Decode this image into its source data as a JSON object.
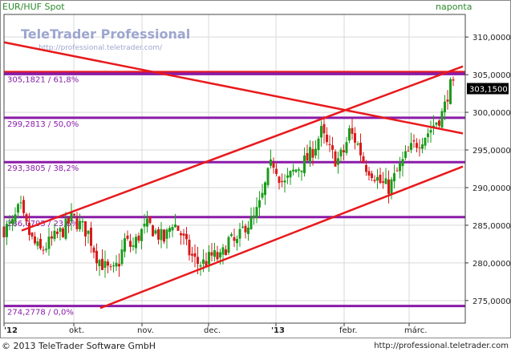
{
  "header": {
    "instrument": "EUR/HUF Spot",
    "period": "naponta"
  },
  "watermark": {
    "brand": "TeleTrader Professional",
    "url": "http://professional.teletrader.com/"
  },
  "footer": {
    "copyright": "© 2013 TeleTrader Software GmbH",
    "url": "http://professional.teletrader.com"
  },
  "colors": {
    "background": "#ffffff",
    "grid": "#d9d9d9",
    "up_candle": "#1c9c1c",
    "down_candle": "#d81b1b",
    "fib_line": "#8a1ba8",
    "trend_line": "#e8191c",
    "header_text": "#2b8a2b",
    "price_box": "#000000"
  },
  "chart_data": {
    "type": "candlestick",
    "y_axis": {
      "range": [
        272,
        313
      ],
      "ticks": [
        "310,0000",
        "305,0000",
        "300,0000",
        "295,0000",
        "290,0000",
        "285,0000",
        "280,0000",
        "275,0000"
      ],
      "tick_values": [
        310,
        305,
        300,
        295,
        290,
        285,
        280,
        275
      ],
      "position": "right"
    },
    "x_axis": {
      "ticks": [
        "'12",
        "okt.",
        "nov.",
        "dec.",
        "'13",
        "febr.",
        "márc."
      ],
      "tick_days": [
        0,
        87,
        172,
        255,
        339,
        424,
        505
      ]
    },
    "last_price": "303,1500",
    "last_price_value": 303.15,
    "fibonacci_levels": [
      {
        "label": "305,1821 / 61,8%",
        "value": 305.1821
      },
      {
        "label": "299,2813 / 50,0%",
        "value": 299.2813
      },
      {
        "label": "293,3805 / 38,2%",
        "value": 293.3805
      },
      {
        "label": "286,0795 / 23,6%",
        "value": 286.0795
      },
      {
        "label": "274,2778 / 0,0%",
        "value": 274.2778
      }
    ],
    "trendlines": [
      {
        "name": "descending resistance",
        "from": [
          0,
          309.3
        ],
        "to": [
          572,
          297.2
        ]
      },
      {
        "name": "channel top",
        "from": [
          22,
          284.3
        ],
        "to": [
          572,
          306.1
        ]
      },
      {
        "name": "channel bottom",
        "from": [
          120,
          274.0
        ],
        "to": [
          572,
          292.8
        ]
      }
    ],
    "price_path": {
      "days": [
        0,
        10,
        20,
        25,
        35,
        45,
        55,
        65,
        75,
        85,
        95,
        105,
        115,
        125,
        135,
        145,
        150,
        160,
        170,
        180,
        190,
        200,
        210,
        220,
        230,
        240,
        250,
        260,
        270,
        280,
        290,
        300,
        310,
        320,
        325,
        330,
        335,
        340,
        345,
        350,
        360,
        370,
        380,
        390,
        395,
        405,
        415,
        425,
        430,
        440,
        450,
        460,
        470,
        480,
        490,
        500,
        510,
        520,
        530,
        540,
        545,
        550,
        555,
        560
      ],
      "closes": [
        284.5,
        285.0,
        287.5,
        285.5,
        283.0,
        281.5,
        282.5,
        283.5,
        284.5,
        286.0,
        285.0,
        284.0,
        281.0,
        279.5,
        278.5,
        280.5,
        283.0,
        282.0,
        284.0,
        285.0,
        284.0,
        283.0,
        285.5,
        284.0,
        281.5,
        280.0,
        280.0,
        281.0,
        280.5,
        283.0,
        282.5,
        285.0,
        285.5,
        288.0,
        290.0,
        292.0,
        293.5,
        292.5,
        291.0,
        290.5,
        292.0,
        293.0,
        294.0,
        296.0,
        297.5,
        295.0,
        293.5,
        295.0,
        297.5,
        296.0,
        293.0,
        292.0,
        290.5,
        290.0,
        292.0,
        294.0,
        295.5,
        296.5,
        297.5,
        299.0,
        299.5,
        301.0,
        303.5,
        303.15
      ]
    }
  }
}
